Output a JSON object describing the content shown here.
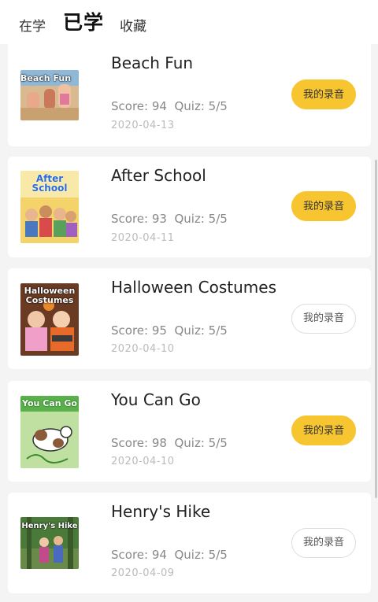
{
  "tabs": [
    {
      "label": "在学"
    },
    {
      "label": "已学"
    },
    {
      "label": "收藏"
    }
  ],
  "items": [
    {
      "title": "Beach Fun",
      "score": "Score: 94",
      "quiz": "Quiz: 5/5",
      "date": "2020-04-13",
      "button": "我的录音",
      "button_state": "active",
      "thumb_text": "Beach Fun"
    },
    {
      "title": "After School",
      "score": "Score: 93",
      "quiz": "Quiz: 5/5",
      "date": "2020-04-11",
      "button": "我的录音",
      "button_state": "active",
      "thumb_text": "After School"
    },
    {
      "title": "Halloween Costumes",
      "score": "Score: 95",
      "quiz": "Quiz: 5/5",
      "date": "2020-04-10",
      "button": "我的录音",
      "button_state": "inactive",
      "thumb_text": "Halloween Costumes"
    },
    {
      "title": "You Can Go",
      "score": "Score: 98",
      "quiz": "Quiz: 5/5",
      "date": "2020-04-10",
      "button": "我的录音",
      "button_state": "active",
      "thumb_text": "You Can Go"
    },
    {
      "title": "Henry's Hike",
      "score": "Score: 94",
      "quiz": "Quiz: 5/5",
      "date": "2020-04-09",
      "button": "我的录音",
      "button_state": "inactive",
      "thumb_text": "Henry's Hike"
    }
  ],
  "colors": {
    "accent": "#f7c52f",
    "background": "#f4f4f4",
    "card": "#ffffff",
    "muted_text": "#888888"
  }
}
